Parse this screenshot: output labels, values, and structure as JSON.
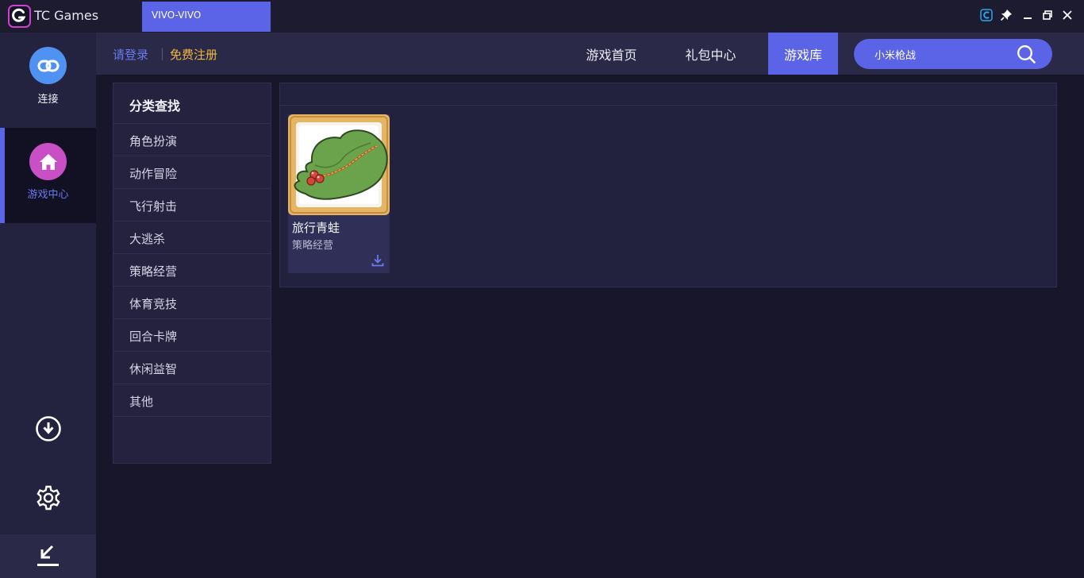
{
  "titlebar": {
    "app_name": "TC Games",
    "device_tab": "VIVO-VIVO",
    "controls": [
      "c-app-icon",
      "pin-icon",
      "minimize-icon",
      "restore-icon",
      "close-icon"
    ]
  },
  "sidebar": {
    "items": [
      {
        "label": "连接",
        "icon": "link-icon",
        "active": false
      },
      {
        "label": "游戏中心",
        "icon": "home-icon",
        "active": true
      }
    ],
    "bottom_icons": [
      "download-icon",
      "gear-icon",
      "shrink-icon"
    ]
  },
  "auth": {
    "login": "请登录",
    "separator": "|",
    "register": "免费注册"
  },
  "nav": {
    "tabs": [
      {
        "label": "游戏首页",
        "active": false
      },
      {
        "label": "礼包中心",
        "active": false
      },
      {
        "label": "游戏库",
        "active": true
      }
    ]
  },
  "search": {
    "value": "小米枪战",
    "placeholder": ""
  },
  "categories": {
    "title": "分类查找",
    "items": [
      "角色扮演",
      "动作冒险",
      "飞行射击",
      "大逃杀",
      "策略经营",
      "体育竞技",
      "回合卡牌",
      "休闲益智",
      "其他"
    ]
  },
  "games": [
    {
      "name": "旅行青蛙",
      "category": "策略经营",
      "icon": "frog-hat-icon"
    }
  ],
  "colors": {
    "accent": "#5b63e6",
    "background": "#17162a",
    "panel": "#24223f",
    "register": "#f0b83f",
    "link_icon_bg": "#4f92f2",
    "home_icon_bg": "#c94fc4"
  }
}
